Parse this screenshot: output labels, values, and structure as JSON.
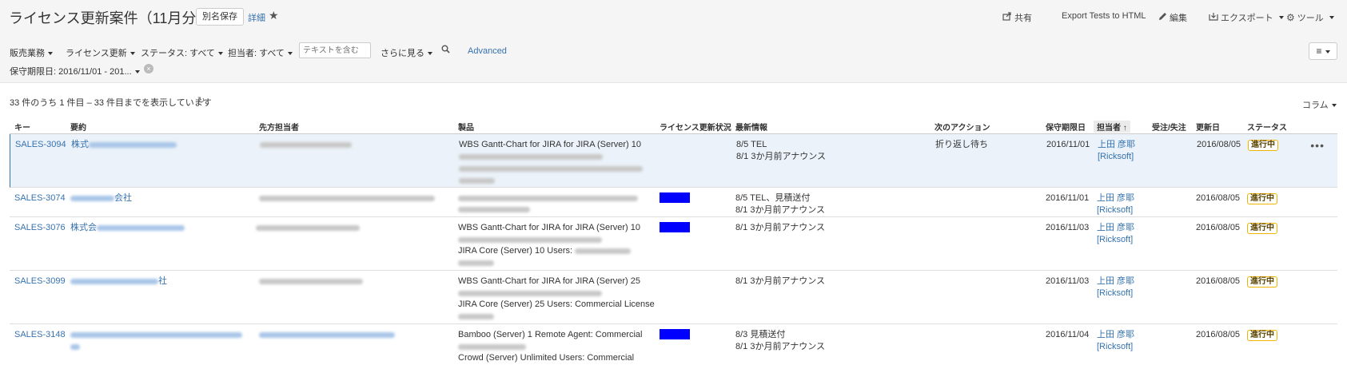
{
  "header": {
    "title": "ライセンス更新案件（11月分）",
    "save_as": "別名保存",
    "details": "詳細",
    "share": "共有",
    "export_tests": "Export Tests to HTML",
    "edit": "編集",
    "export": "エクスポート",
    "tools": "ツール"
  },
  "filters": {
    "sales": "販売業務",
    "license_renewal": "ライセンス更新",
    "status": "ステータス: すべて",
    "assignee": "担当者: すべて",
    "text_placeholder": "テキストを含む",
    "more": "さらに見る",
    "advanced": "Advanced",
    "date": "保守期限日: 2016/11/01 - 201..."
  },
  "results": {
    "count_text": "33 件のうち 1 件目 – 33 件目までを表示しています",
    "columns": "コラム"
  },
  "table": {
    "headers": {
      "key": "キー",
      "summary": "要約",
      "contact": "先方担当者",
      "product": "製品",
      "license_status": "ライセンス更新状況",
      "latest_info": "最新情報",
      "next_action": "次のアクション",
      "due": "保守期限日",
      "assignee": "担当者",
      "order": "受注/失注",
      "updated": "更新日",
      "status": "ステータス"
    },
    "rows": [
      {
        "key": "SALES-3094",
        "summary": "株式",
        "product1": "WBS Gantt-Chart for JIRA for JIRA (Server) 10",
        "product2": "",
        "info1": "8/5 TEL",
        "info2": "8/1 3か月前アナウンス",
        "next_action": "折り返し待ち",
        "due": "2016/11/01",
        "assignee": "上田 彦耶",
        "assignee2": "[Ricksoft]",
        "updated": "2016/08/05",
        "status": "進行中"
      },
      {
        "key": "SALES-3074",
        "summary": "会社",
        "product1": "",
        "product2": "",
        "info1": "8/5 TEL、見積送付",
        "info2": "8/1 3か月前アナウンス",
        "next_action": "",
        "due": "2016/11/01",
        "assignee": "上田 彦耶",
        "assignee2": "[Ricksoft]",
        "updated": "2016/08/05",
        "status": "進行中"
      },
      {
        "key": "SALES-3076",
        "summary": "株式会",
        "product1": "WBS Gantt-Chart for JIRA for JIRA (Server) 10",
        "product2": "JIRA Core (Server) 10 Users:",
        "info1": "8/1 3か月前アナウンス",
        "info2": "",
        "next_action": "",
        "due": "2016/11/03",
        "assignee": "上田 彦耶",
        "assignee2": "[Ricksoft]",
        "updated": "2016/08/05",
        "status": "進行中"
      },
      {
        "key": "SALES-3099",
        "summary": "社",
        "product1": "WBS Gantt-Chart for JIRA for JIRA (Server) 25",
        "product2": "JIRA Core (Server) 25 Users: Commercial License",
        "info1": "8/1 3か月前アナウンス",
        "info2": "",
        "next_action": "",
        "due": "2016/11/03",
        "assignee": "上田 彦耶",
        "assignee2": "[Ricksoft]",
        "updated": "2016/08/05",
        "status": "進行中"
      },
      {
        "key": "SALES-3148",
        "summary": "",
        "product1": "Bamboo (Server) 1 Remote Agent: Commercial",
        "product2": "Crowd (Server) Unlimited Users: Commercial",
        "info1": "8/3 見積送付",
        "info2": "8/1 3か月前アナウンス",
        "next_action": "",
        "due": "2016/11/04",
        "assignee": "上田 彦耶",
        "assignee2": "[Ricksoft]",
        "updated": "2016/08/05",
        "status": "進行中"
      }
    ]
  },
  "colors": {
    "link": "#3572b0",
    "license_indicator": "#0000ff",
    "status_border": "#f0b400"
  }
}
